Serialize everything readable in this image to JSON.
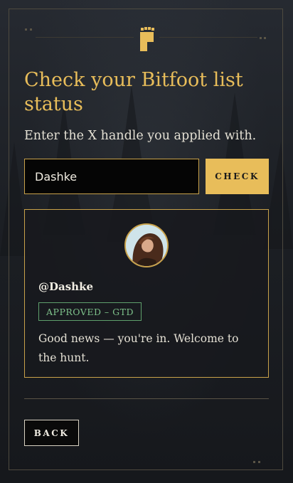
{
  "header": {
    "logo_icon": "bitfoot-footprint-icon",
    "title": "Check your Bitfoot list status",
    "subtitle": "Enter the X handle you applied with."
  },
  "search": {
    "value": "Dashke",
    "button_label": "CHECK"
  },
  "result": {
    "avatar_icon": "user-avatar",
    "handle": "@Dashke",
    "status": "APPROVED – GTD",
    "message": "Good news — you're in. Welcome to the hunt."
  },
  "footer": {
    "back_label": "BACK"
  },
  "colors": {
    "accent": "#e8bd5a",
    "approved": "#7ec28b",
    "background": "#1b1d22"
  }
}
